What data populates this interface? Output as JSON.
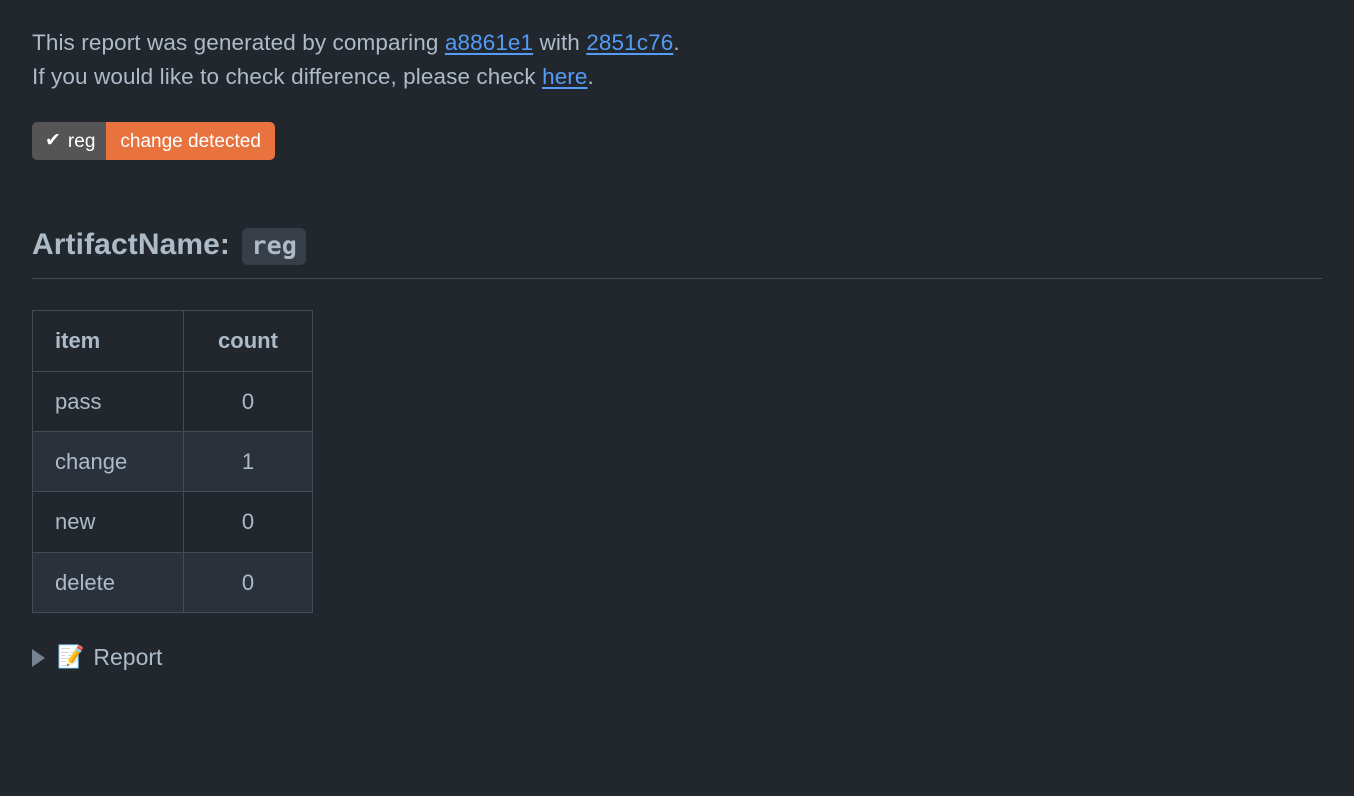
{
  "intro": {
    "line1_prefix": "This report was generated by comparing ",
    "base_commit": "a8861e1",
    "line1_middle": " with ",
    "head_commit": "2851c76",
    "line1_suffix": ".",
    "line2_prefix": "If you would like to check difference, please check ",
    "here_link": "here",
    "line2_suffix": "."
  },
  "badge": {
    "check_icon": "✔",
    "left_label": "reg",
    "right_label": "change detected",
    "left_color": "#555555",
    "right_color": "#e8733f"
  },
  "heading": {
    "label": "ArtifactName:",
    "artifact_name": "reg"
  },
  "table": {
    "headers": [
      "item",
      "count"
    ],
    "rows": [
      {
        "item": "pass",
        "count": "0"
      },
      {
        "item": "change",
        "count": "1"
      },
      {
        "item": "new",
        "count": "0"
      },
      {
        "item": "delete",
        "count": "0"
      }
    ]
  },
  "report": {
    "memo_icon": "📝",
    "label": "Report"
  },
  "theme": {
    "background": "#22272e",
    "text": "#adbac7",
    "link": "#539bf5",
    "border": "#444c56",
    "code_bg": "#373e47",
    "stripe_bg": "#2b313a"
  },
  "chart_data": null
}
